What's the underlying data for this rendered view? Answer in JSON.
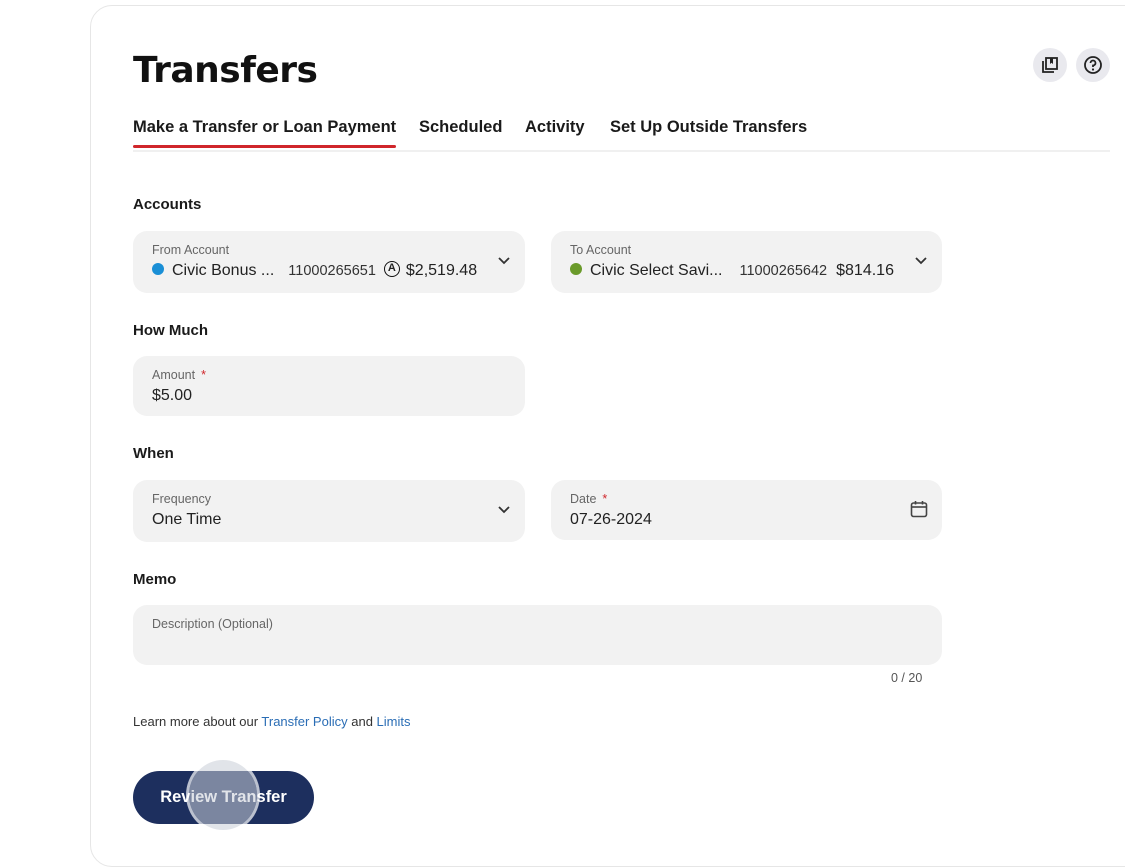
{
  "page": {
    "title": "Transfers"
  },
  "header_icons": [
    {
      "name": "bookmarks-icon"
    },
    {
      "name": "help-icon",
      "glyph": "?"
    }
  ],
  "tabs": [
    {
      "label": "Make a Transfer or Loan Payment",
      "active": true
    },
    {
      "label": "Scheduled",
      "active": false
    },
    {
      "label": "Activity",
      "active": false
    },
    {
      "label": "Set Up Outside Transfers",
      "active": false
    }
  ],
  "accounts": {
    "label": "Accounts",
    "from": {
      "label": "From Account",
      "name": "Civic Bonus ...",
      "number": "11000265651",
      "badge": "A",
      "balance": "$2,519.48",
      "dot_color": "#1a8fd6"
    },
    "to": {
      "label": "To Account",
      "name": "Civic Select Savi...",
      "number": "11000265642",
      "balance": "$814.16",
      "dot_color": "#6a9a2a"
    }
  },
  "how_much": {
    "label": "How Much",
    "amount_label": "Amount",
    "required_mark": "*",
    "amount_value": "$5.00"
  },
  "when": {
    "label": "When",
    "frequency_label": "Frequency",
    "frequency_value": "One Time",
    "date_label": "Date",
    "required_mark": "*",
    "date_value": "07-26-2024"
  },
  "memo": {
    "label": "Memo",
    "placeholder": "Description (Optional)",
    "counter": "0 / 20"
  },
  "learn_more": {
    "prefix": "Learn more about our ",
    "link1": "Transfer Policy",
    "middle": " and ",
    "link2": "Limits"
  },
  "actions": {
    "review_label": "Review Transfer"
  },
  "colors": {
    "accent_tab": "#d0262b",
    "primary_button": "#1d2f5e",
    "link": "#2a6db5"
  }
}
